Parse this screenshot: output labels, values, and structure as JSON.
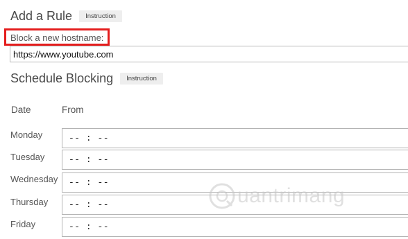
{
  "add_rule": {
    "title": "Add a Rule",
    "instruction_label": "Instruction",
    "hostname_label": "Block a new hostname:",
    "hostname_value": "https://www.youtube.com"
  },
  "schedule": {
    "title": "Schedule Blocking",
    "instruction_label": "Instruction",
    "col_date": "Date",
    "col_from": "From",
    "days": [
      {
        "label": "Monday",
        "from": "-- : --"
      },
      {
        "label": "Tuesday",
        "from": "-- : --"
      },
      {
        "label": "Wednesday",
        "from": "-- : --"
      },
      {
        "label": "Thursday",
        "from": "-- : --"
      },
      {
        "label": "Friday",
        "from": "-- : --"
      }
    ]
  },
  "highlight_color": "#e41d1d",
  "watermark": {
    "text": "uantrimang",
    "icon": "quantrimang-logo-icon"
  }
}
